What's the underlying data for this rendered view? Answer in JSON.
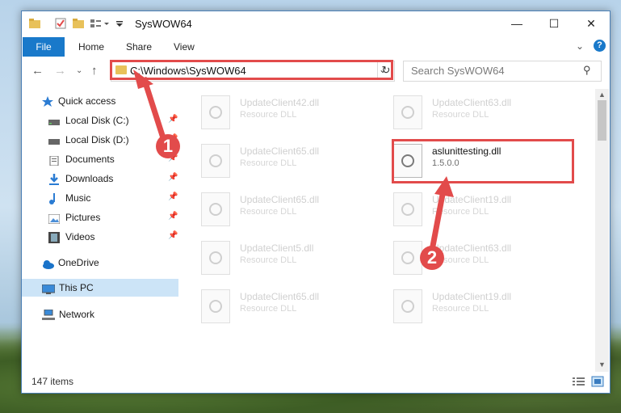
{
  "window": {
    "title": "SysWOW64"
  },
  "ribbon": {
    "file_tab": "File",
    "tabs": [
      "Home",
      "Share",
      "View"
    ]
  },
  "address": {
    "path": "C:\\Windows\\SysWOW64"
  },
  "search": {
    "placeholder": "Search SysWOW64"
  },
  "sidebar": {
    "items": [
      {
        "label": "Quick access",
        "icon": "star-icon",
        "pinned": false
      },
      {
        "label": "Local Disk (C:)",
        "icon": "drive-icon",
        "pinned": true
      },
      {
        "label": "Local Disk (D:)",
        "icon": "drive-icon",
        "pinned": true
      },
      {
        "label": "Documents",
        "icon": "document-icon",
        "pinned": true
      },
      {
        "label": "Downloads",
        "icon": "download-icon",
        "pinned": true
      },
      {
        "label": "Music",
        "icon": "music-icon",
        "pinned": true
      },
      {
        "label": "Pictures",
        "icon": "pictures-icon",
        "pinned": true
      },
      {
        "label": "Videos",
        "icon": "videos-icon",
        "pinned": true
      },
      {
        "label": "OneDrive",
        "icon": "cloud-icon",
        "pinned": false
      },
      {
        "label": "This PC",
        "icon": "computer-icon",
        "pinned": false,
        "selected": true
      },
      {
        "label": "Network",
        "icon": "network-icon",
        "pinned": false
      }
    ]
  },
  "files": [
    {
      "name": "UpdateClient42.dll",
      "type": "Resource DLL"
    },
    {
      "name": "UpdateClient63.dll",
      "type": "Resource DLL"
    },
    {
      "name": "UpdateClient65.dll",
      "type": "Resource DLL"
    },
    {
      "name": "aslunittesting.dll",
      "type": "1.5.0.0",
      "active": true
    },
    {
      "name": "UpdateClient65.dll",
      "type": "Resource DLL"
    },
    {
      "name": "UpdateClient19.dll",
      "type": "Resource DLL"
    },
    {
      "name": "UpdateClient5.dll",
      "type": "Resource DLL"
    },
    {
      "name": "UpdateClient63.dll",
      "type": "Resource DLL"
    },
    {
      "name": "UpdateClient65.dll",
      "type": "Resource DLL"
    },
    {
      "name": "UpdateClient19.dll",
      "type": "Resource DLL"
    }
  ],
  "status": {
    "item_count": "147 items"
  },
  "annotations": {
    "step1": "1",
    "step2": "2"
  },
  "colors": {
    "accent": "#1979ca",
    "highlight": "#e24b4b",
    "selected": "#cce4f7"
  }
}
